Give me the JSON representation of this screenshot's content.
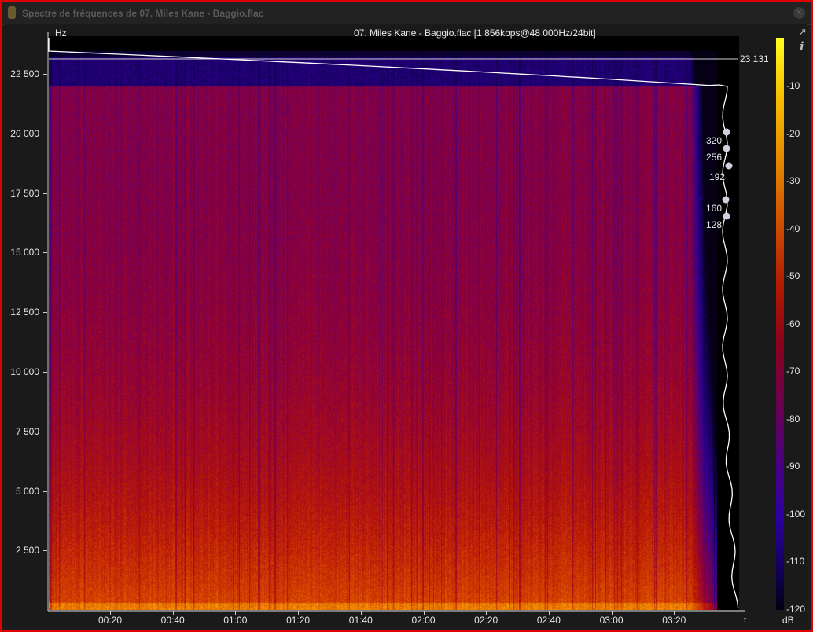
{
  "window": {
    "title": "Spectre de fréquences de 07. Miles Kane - Baggio.flac",
    "close_label": "×"
  },
  "plot": {
    "file_title": "07. Miles Kane - Baggio.flac [1 856kbps@48 000Hz/24bit]",
    "y_axis_label": "Hz",
    "x_axis_label": "t",
    "colorbar_label": "dB",
    "y_ticks": [
      "22 500",
      "20 000",
      "17 500",
      "15 000",
      "12 500",
      "10 000",
      "7 500",
      "5 000",
      "2 500"
    ],
    "x_ticks": [
      "00:20",
      "00:40",
      "01:00",
      "01:20",
      "01:40",
      "02:00",
      "02:20",
      "02:40",
      "03:00",
      "03:20"
    ],
    "db_ticks": [
      "-10",
      "-20",
      "-30",
      "-40",
      "-50",
      "-60",
      "-70",
      "-80",
      "-90",
      "-100",
      "-110",
      "-120"
    ],
    "cutoff_label": "23 131",
    "bitrate_markers": [
      "320",
      "256",
      "192",
      "160",
      "128"
    ]
  },
  "icons": {
    "popout": "popout-icon",
    "info": "info-icon"
  }
}
